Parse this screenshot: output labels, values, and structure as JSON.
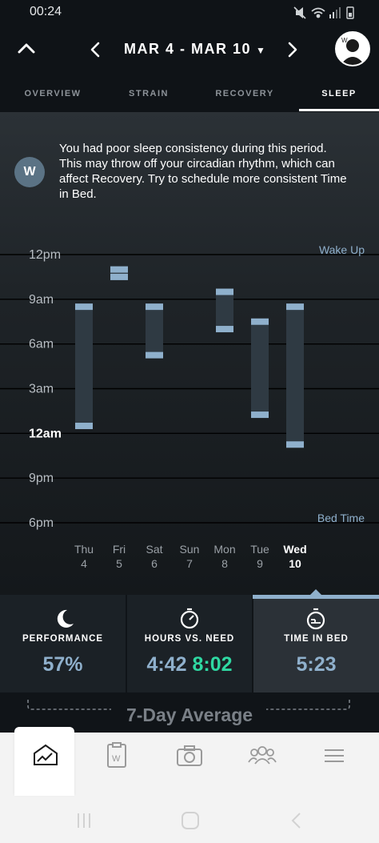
{
  "status_bar": {
    "time": "00:24",
    "icons": [
      "mute-icon",
      "wifi-icon",
      "signal-icon",
      "battery-icon"
    ]
  },
  "header": {
    "date_range": "MAR 4 - MAR 10",
    "collapse_icon": "chevron-up-icon",
    "prev_icon": "chevron-left-icon",
    "next_icon": "chevron-right-icon",
    "dropdown_icon": "caret-down-icon",
    "avatar_icon": "profile-icon"
  },
  "tabs": [
    {
      "label": "OVERVIEW",
      "active": false
    },
    {
      "label": "STRAIN",
      "active": false
    },
    {
      "label": "RECOVERY",
      "active": false
    },
    {
      "label": "SLEEP",
      "active": true
    }
  ],
  "insight": {
    "icon": "whoop-logo-icon",
    "icon_text": "W",
    "text": "You had poor sleep consistency during this period. This may throw off your circadian rhythm, which can affect Recovery. Try to schedule more consistent Time in Bed."
  },
  "chart_data": {
    "type": "range-bar",
    "top_label": "Wake Up",
    "bottom_label": "Bed Time",
    "y_ticks": [
      "12pm",
      "9am",
      "6am",
      "3am",
      "12am",
      "9pm",
      "6pm"
    ],
    "y_ticks_hours_offset": [
      18,
      15,
      12,
      9,
      6,
      3,
      0
    ],
    "ylim_hours_after_6pm": [
      0,
      18
    ],
    "grid": true,
    "days": [
      {
        "dow": "Thu",
        "date": "4",
        "bed_time": "12:30am",
        "wake_time": "8:30am",
        "bed": 6.5,
        "wake": 14.5
      },
      {
        "dow": "Fri",
        "date": "5",
        "bed_time": "10:30am",
        "wake_time": "11:00am",
        "bed": 16.5,
        "wake": 17.0
      },
      {
        "dow": "Sat",
        "date": "6",
        "bed_time": "5:15am",
        "wake_time": "8:30am",
        "bed": 11.25,
        "wake": 14.5
      },
      {
        "dow": "Sun",
        "date": "7",
        "bed_time": null,
        "wake_time": null,
        "bed": null,
        "wake": null
      },
      {
        "dow": "Mon",
        "date": "8",
        "bed_time": "7:00am",
        "wake_time": "9:30am",
        "bed": 13.0,
        "wake": 15.5
      },
      {
        "dow": "Tue",
        "date": "9",
        "bed_time": "1:15am",
        "wake_time": "7:30am",
        "bed": 7.25,
        "wake": 13.5
      },
      {
        "dow": "Wed",
        "date": "10",
        "bed_time": "11:15pm",
        "wake_time": "8:30am",
        "bed": 5.25,
        "wake": 14.5,
        "current": true
      }
    ],
    "colors": {
      "bar": "#2f3a43",
      "cap": "#8fb0cc",
      "grid": "#000000",
      "label": "#b8bec4",
      "edge_label": "#8fb0cc"
    }
  },
  "metrics": [
    {
      "icon": "moon-icon",
      "label": "PERFORMANCE",
      "value": "57%",
      "selected": false
    },
    {
      "icon": "stopwatch-icon",
      "label": "HOURS VS. NEED",
      "value_hours": "4:42",
      "value_need": "8:02",
      "selected": false
    },
    {
      "icon": "bed-clock-icon",
      "label": "TIME IN BED",
      "value": "5:23",
      "selected": true
    }
  ],
  "colors": {
    "accent": "#8fb0cc",
    "need_green": "#2fd8a2",
    "bg": "#101418"
  },
  "average_label": "7-Day Average",
  "bottom_nav": [
    {
      "name": "home",
      "icon": "home-chart-icon",
      "active": true
    },
    {
      "name": "journal",
      "icon": "journal-icon",
      "active": false
    },
    {
      "name": "camera",
      "icon": "camera-icon",
      "active": false
    },
    {
      "name": "community",
      "icon": "team-icon",
      "active": false
    },
    {
      "name": "menu",
      "icon": "menu-icon",
      "active": false
    }
  ],
  "system_nav": [
    "recents-icon",
    "home-icon",
    "back-icon"
  ]
}
